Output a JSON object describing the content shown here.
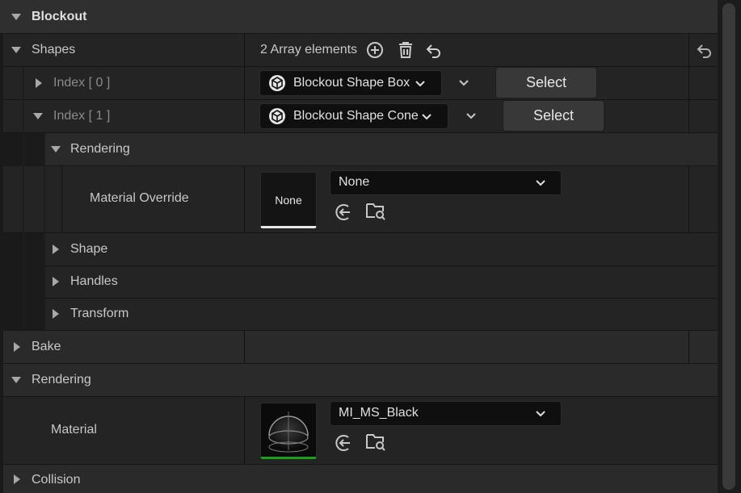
{
  "header": {
    "title": "Blockout"
  },
  "shapes": {
    "label": "Shapes",
    "array_count_text": "2 Array elements",
    "items": [
      {
        "index_label": "Index [ 0 ]",
        "shape_value": "Blockout Shape Box",
        "select_label": "Select"
      },
      {
        "index_label": "Index [ 1 ]",
        "shape_value": "Blockout Shape Cone",
        "select_label": "Select"
      }
    ]
  },
  "item_rendering": {
    "label": "Rendering",
    "material_override": {
      "label": "Material Override",
      "thumbnail_text": "None",
      "value": "None"
    }
  },
  "item_subsections": [
    "Shape",
    "Handles",
    "Transform"
  ],
  "bake": {
    "label": "Bake"
  },
  "rendering": {
    "label": "Rendering",
    "material": {
      "label": "Material",
      "value": "MI_MS_Black"
    }
  },
  "collision": {
    "label": "Collision"
  },
  "icons": {
    "expand": "triangle-down-icon",
    "collapse": "triangle-right-icon",
    "add": "plus-circle-icon",
    "delete": "trash-icon",
    "reset": "undo-arrow-icon",
    "shape": "cube-icon",
    "dropdown": "chevron-down-icon",
    "use_selected": "arrow-left-circle-icon",
    "browse": "folder-search-icon"
  },
  "colors": {
    "background": "#1a1a1a",
    "panel": "#242424",
    "header": "#2f2f2f",
    "field": "#0f0f0f",
    "button": "#383838",
    "material_accent": "#1e9e1e"
  }
}
